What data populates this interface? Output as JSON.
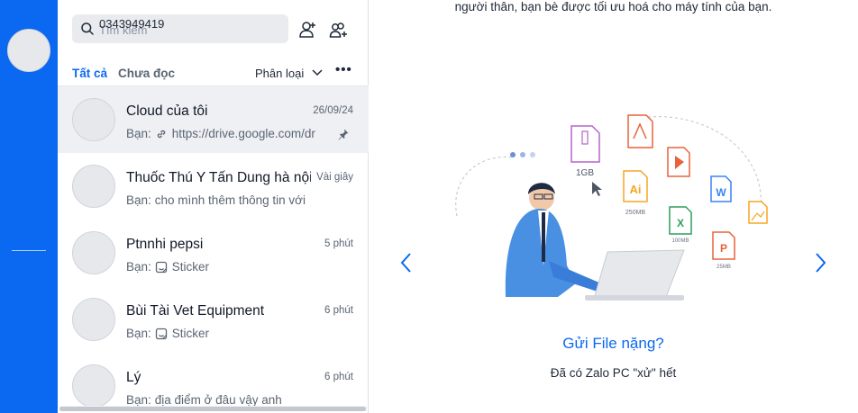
{
  "search": {
    "placeholder": "Tìm kiếm",
    "value": "0343949419"
  },
  "filters": {
    "all_label": "Tất cả",
    "unread_label": "Chưa đọc",
    "sort_label": "Phân loại",
    "more_label": "•••"
  },
  "conversations": [
    {
      "name": "Cloud của tôi",
      "time": "26/09/24",
      "sender": "Bạn:",
      "preview": "https://drive.google.com/dr",
      "preview_icon": "link-icon",
      "pinned": true,
      "active": true
    },
    {
      "name": "Thuốc Thú Y Tấn Dung hà nội",
      "time": "Vài giây",
      "sender": "Bạn:",
      "preview": "cho mình thêm thông tin với"
    },
    {
      "name": "Ptnnhi pepsi",
      "time": "5 phút",
      "sender": "Bạn:",
      "preview": "Sticker",
      "preview_icon": "sticker-icon"
    },
    {
      "name": "Bùi Tài Vet Equipment",
      "time": "6 phút",
      "sender": "Bạn:",
      "preview": "Sticker",
      "preview_icon": "sticker-icon"
    },
    {
      "name": "Lý",
      "time": "6 phút",
      "sender": "Bạn:",
      "preview": "địa điểm ở đâu vậy anh"
    }
  ],
  "main": {
    "top_text": "người thân, bạn bè được tối ưu hoá cho máy tính của bạn.",
    "slide_title": "Gửi File nặng?",
    "slide_subtitle": "Đã có Zalo PC \"xử\" hết",
    "illustration": {
      "file_size_label": "1GB",
      "ai_label": "Ai",
      "ai_size": "250MB",
      "excel_label": "X",
      "excel_size": "100MB",
      "word_label": "W",
      "ppt_label": "P",
      "ppt_size": "25MB"
    }
  },
  "colors": {
    "brand": "#0b68f0",
    "rail": "#0b68f0",
    "active_row": "#eef0f4"
  }
}
